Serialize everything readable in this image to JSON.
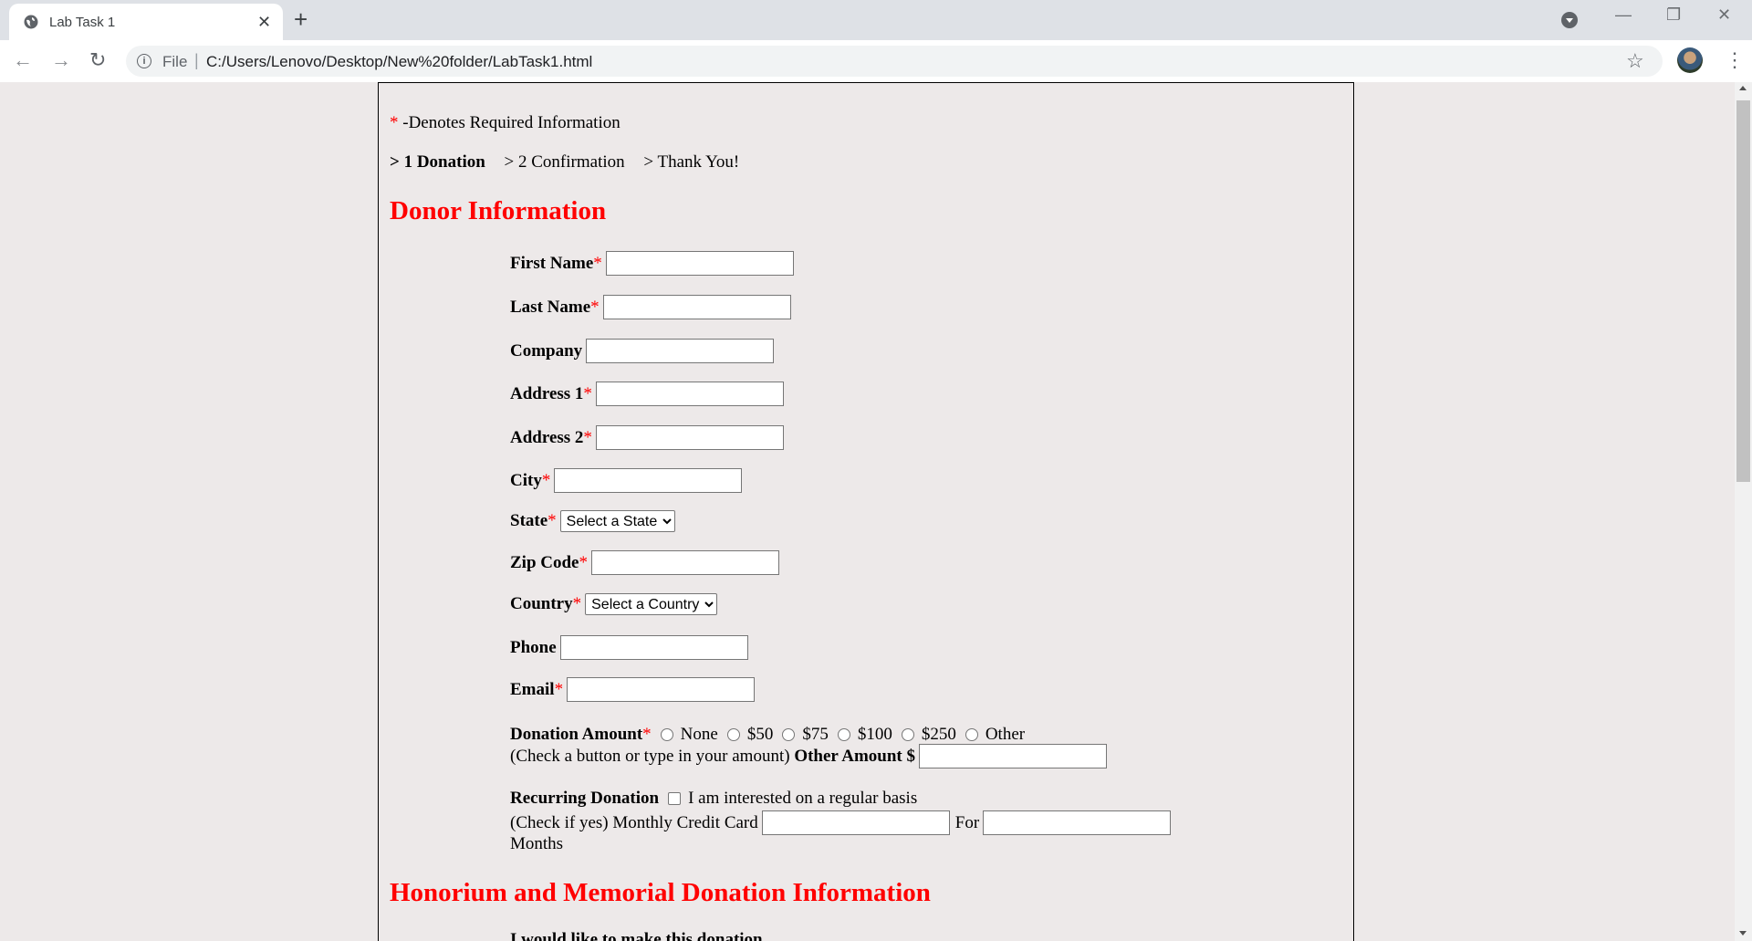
{
  "browser": {
    "tab_title": "Lab Task 1",
    "url_scheme": "File",
    "url": "C:/Users/Lenovo/Desktop/New%20folder/LabTask1.html"
  },
  "page": {
    "required_note": "-Denotes Required Information",
    "steps": [
      "> 1 Donation",
      "> 2 Confirmation",
      "> Thank You!"
    ],
    "donor_heading": "Donor Information",
    "fields": {
      "first_name": "First Name",
      "last_name": "Last Name",
      "company": "Company",
      "address1": "Address 1",
      "address2": "Address 2",
      "city": "City",
      "state": "State",
      "state_select": "Select a State",
      "zip": "Zip Code",
      "country": "Country",
      "country_select": "Select a Country",
      "phone": "Phone",
      "email": "Email"
    },
    "donation": {
      "label": "Donation Amount",
      "options": [
        "None",
        "$50",
        "$75",
        "$100",
        "$250",
        "Other"
      ],
      "hint": "(Check a button or type in your amount)",
      "other_label": "Other Amount $"
    },
    "recurring": {
      "label": "Recurring Donation",
      "checkbox_text": "I am interested on a regular basis",
      "hint": "(Check if yes) Monthly Credit Card",
      "for": "For",
      "months": "Months"
    },
    "honorium_heading": "Honorium and Memorial Donation Information",
    "honorium_first_line": "I would like to make this donation"
  }
}
